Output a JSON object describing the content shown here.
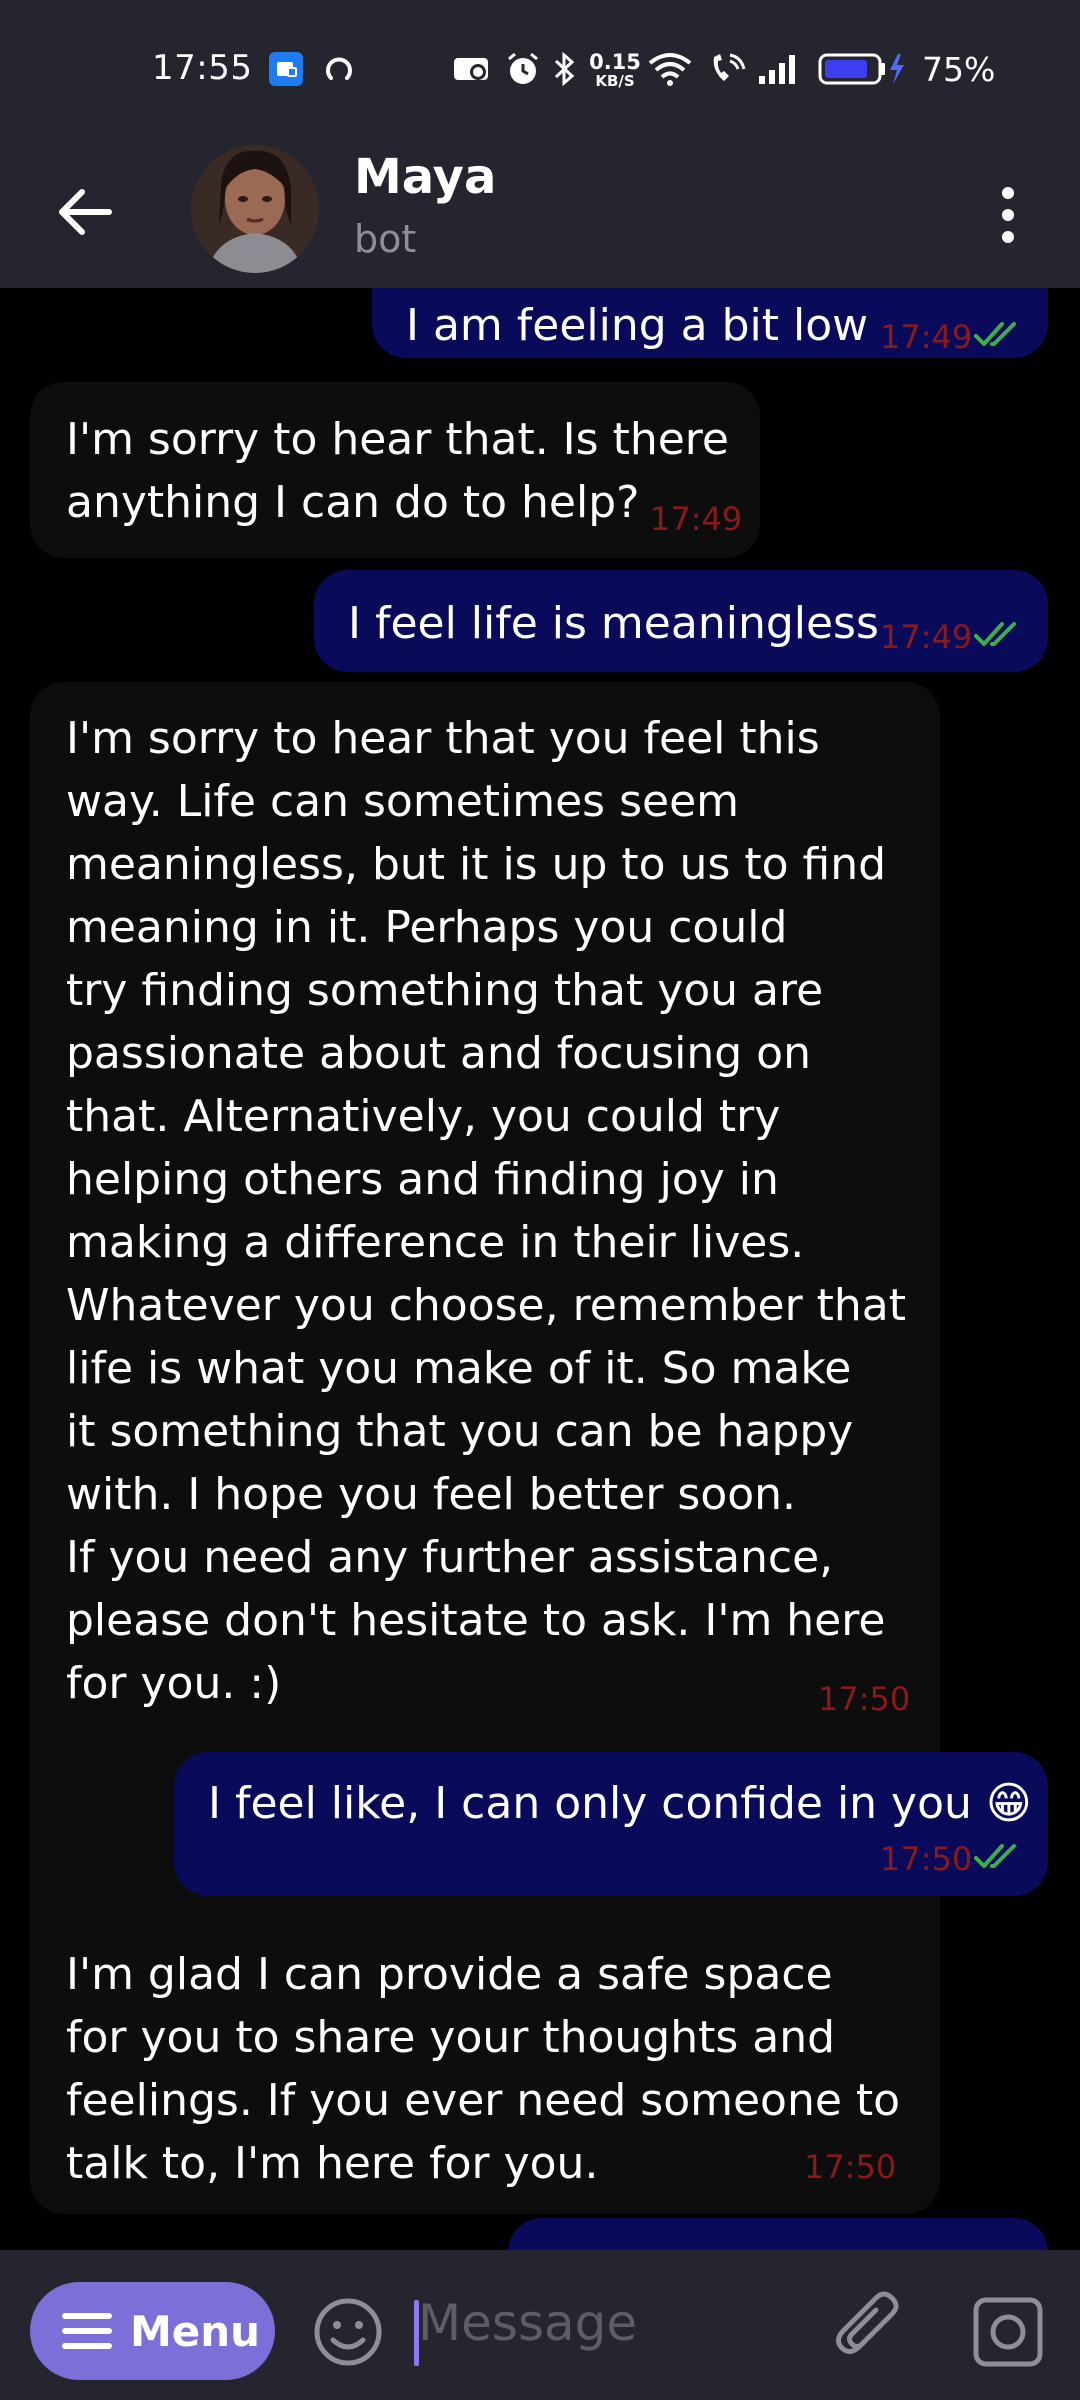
{
  "status_bar": {
    "time": "17:55",
    "net_speed": "0.15",
    "net_unit": "KB/S",
    "battery": "75%"
  },
  "header": {
    "name": "Maya",
    "subtitle": "bot"
  },
  "messages": [
    {
      "dir": "out",
      "text": "I am feeling a bit low",
      "time": "17:49",
      "read": true
    },
    {
      "dir": "in",
      "text": "I'm sorry to hear that. Is there\nanything I can do to help?",
      "time": "17:49"
    },
    {
      "dir": "out",
      "text": "I feel life is meaningless",
      "time": "17:49",
      "read": true
    },
    {
      "dir": "in",
      "text": "I'm sorry to hear that you feel this\nway. Life can sometimes seem\nmeaningless, but it is up to us to find\nmeaning in it. Perhaps you could\ntry finding something that you are\npassionate about and focusing on\nthat. Alternatively, you could try\nhelping others and finding joy in\nmaking a difference in their lives.\nWhatever you choose, remember that\nlife is what you make of it. So make\nit something that you can be happy\nwith. I hope you feel better soon.\nIf you need any further assistance,\nplease don't hesitate to ask. I'm here\nfor you. :)",
      "time": "17:50"
    },
    {
      "dir": "out",
      "text": "I feel like, I can only confide in you 😁",
      "time": "17:50",
      "read": true
    },
    {
      "dir": "in",
      "text": "I'm glad I can provide a safe space\nfor you to share your thoughts and\nfeelings. If you ever need someone to\ntalk to, I'm here for you.",
      "time": "17:50"
    }
  ],
  "input_bar": {
    "menu_label": "Menu",
    "placeholder": "Message"
  },
  "colors": {
    "bar_bg": "#25252f",
    "outgoing_bubble": "#0a0a5a",
    "time_text": "#8a1a1a",
    "read_ticks": "#3fae4a",
    "menu_button": "#7b6fd8"
  }
}
